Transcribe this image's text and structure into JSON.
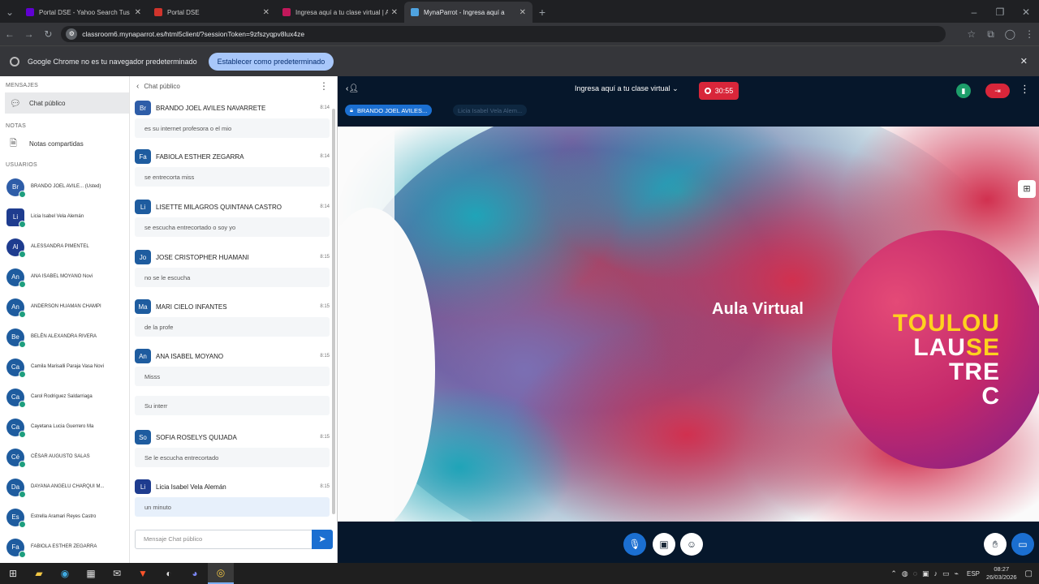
{
  "browser": {
    "tabs": [
      {
        "title": "Portal DSE - Yahoo Search Tus r",
        "color": "#6001d2"
      },
      {
        "title": "Portal DSE",
        "color": "#d0342c"
      },
      {
        "title": "Ingresa aquí a tu clase virtual | A",
        "color": "#c2185b"
      },
      {
        "title": "MynaParrot - Ingresa aquí a",
        "color": "#4fa3e0"
      }
    ],
    "url": "classroom6.mynaparrot.es/html5client/?sessionToken=9zfszyqpv8lux4ze",
    "infobar_text": "Google Chrome no es tu navegador predeterminado",
    "infobar_button": "Establecer como predeterminado"
  },
  "sidebar": {
    "mensajes_label": "MENSAJES",
    "chat_item": "Chat público",
    "notas_label": "NOTAS",
    "notas_item": "Notas compartidas",
    "usuarios_label": "USUARIOS",
    "users": [
      {
        "initials": "Br",
        "name": "BRANDO JOEL AVILE... (Usted)",
        "color": "#2e5da8",
        "sq": false
      },
      {
        "initials": "Li",
        "name": "Licia Isabel Vela Alemán",
        "color": "#1e3c8f",
        "sq": true
      },
      {
        "initials": "Al",
        "name": "ALESSANDRA PIMENTEL",
        "color": "#1e3c8f",
        "sq": false
      },
      {
        "initials": "An",
        "name": "ANA ISABEL MOYANO Novi",
        "color": "#1e5c9f",
        "sq": false
      },
      {
        "initials": "An",
        "name": "ANDERSON HUAMAN CHAMPI",
        "color": "#1e5c9f",
        "sq": false
      },
      {
        "initials": "Be",
        "name": "BELÉN ALEXANDRA RIVERA",
        "color": "#1e5c9f",
        "sq": false
      },
      {
        "initials": "Ca",
        "name": "Camila Marisalli Paraja Vasa Novi",
        "color": "#1e5c9f",
        "sq": false
      },
      {
        "initials": "Ca",
        "name": "Carol Rodriguez Saldarriaga",
        "color": "#1e5c9f",
        "sq": false
      },
      {
        "initials": "Ca",
        "name": "Cayetana Lucia Guerrero Ma",
        "color": "#1e5c9f",
        "sq": false
      },
      {
        "initials": "Cé",
        "name": "CÉSAR AUGUSTO SALAS",
        "color": "#1e5c9f",
        "sq": false
      },
      {
        "initials": "Da",
        "name": "DAYANA ANGELU CHARQUI M...",
        "color": "#1e5c9f",
        "sq": false
      },
      {
        "initials": "Es",
        "name": "Estrella Aramari Reyes Castro",
        "color": "#1e5c9f",
        "sq": false
      },
      {
        "initials": "Fa",
        "name": "FABIOLA ESTHER ZEGARRA",
        "color": "#1e5c9f",
        "sq": false
      }
    ]
  },
  "chat": {
    "header": "Chat público",
    "messages": [
      {
        "initials": "Br",
        "name": "BRANDO JOEL AVILES NAVARRETE",
        "time": "8:14",
        "text": "es su internet profesora o el mio",
        "color": "#2e5da8"
      },
      {
        "initials": "Fa",
        "name": "FABIOLA ESTHER ZEGARRA",
        "time": "8:14",
        "text": "se entrecorta miss",
        "color": "#1e5c9f"
      },
      {
        "initials": "Li",
        "name": "LISETTE MILAGROS QUINTANA CASTRO",
        "time": "8:14",
        "text": "se escucha entrecortado o soy yo",
        "color": "#1e5c9f"
      },
      {
        "initials": "Jo",
        "name": "JOSE CRISTOPHER HUAMANI",
        "time": "8:15",
        "text": "no se le escucha",
        "color": "#1e5c9f"
      },
      {
        "initials": "Ma",
        "name": "MARI CIELO INFANTES",
        "time": "8:15",
        "text": "de la profe",
        "color": "#1e5c9f"
      },
      {
        "initials": "An",
        "name": "ANA ISABEL MOYANO",
        "time": "8:15",
        "text": "Misss",
        "text2": "Su interr",
        "color": "#1e5c9f"
      },
      {
        "initials": "So",
        "name": "SOFIA ROSELYS QUIJADA",
        "time": "8:15",
        "text": "Se le escucha entrecortado",
        "color": "#1e5c9f"
      },
      {
        "initials": "Li",
        "name": "Licia Isabel Vela Alemán",
        "time": "8:15",
        "text": "un minuto",
        "color": "#1e3c8f"
      }
    ],
    "input_placeholder": "Mensaje Chat público"
  },
  "meeting": {
    "title": "Ingresa aquí a tu clase virtual",
    "timer": "30:55",
    "presenter_pill": "BRANDO JOEL AVILES...",
    "speaker_pill": "Licia Isabel Vela Alem...",
    "slide_title": "Aula Virtual",
    "logo_lines": [
      "TOULOU",
      "LAU",
      "SE",
      "TRE",
      "C"
    ]
  },
  "taskbar": {
    "lang": "ESP",
    "time": "08:27",
    "date": "26/03/2026"
  }
}
